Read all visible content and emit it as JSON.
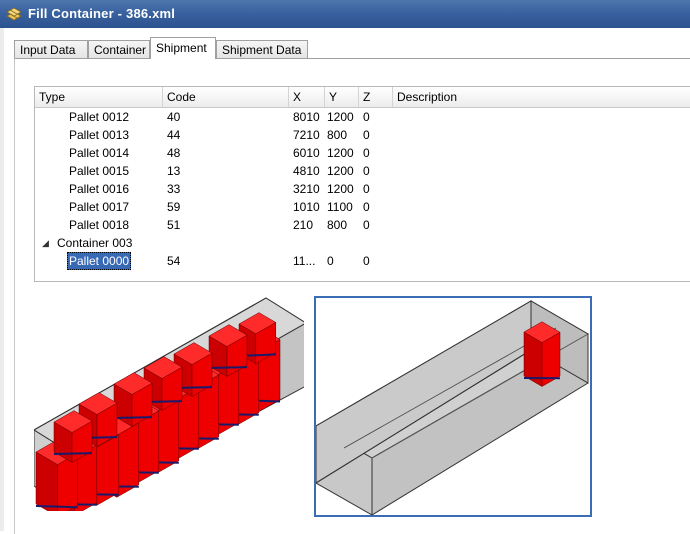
{
  "window": {
    "title": "Fill Container - 386.xml",
    "icon": "container-app-icon"
  },
  "tabs": [
    {
      "label": "Input Data",
      "active": false
    },
    {
      "label": "Container",
      "active": false
    },
    {
      "label": "Shipment",
      "active": true
    },
    {
      "label": "Shipment Data",
      "active": false
    }
  ],
  "grid": {
    "columns": [
      "Type",
      "Code",
      "X",
      "Y",
      "Z",
      "Description"
    ],
    "rows": [
      {
        "type": "Pallet 0012",
        "code": "40",
        "x": "8010",
        "y": "1200",
        "z": "0",
        "description": ""
      },
      {
        "type": "Pallet 0013",
        "code": "44",
        "x": "7210",
        "y": "800",
        "z": "0",
        "description": ""
      },
      {
        "type": "Pallet 0014",
        "code": "48",
        "x": "6010",
        "y": "1200",
        "z": "0",
        "description": ""
      },
      {
        "type": "Pallet 0015",
        "code": "13",
        "x": "4810",
        "y": "1200",
        "z": "0",
        "description": ""
      },
      {
        "type": "Pallet 0016",
        "code": "33",
        "x": "3210",
        "y": "1200",
        "z": "0",
        "description": ""
      },
      {
        "type": "Pallet 0017",
        "code": "59",
        "x": "1010",
        "y": "1100",
        "z": "0",
        "description": ""
      },
      {
        "type": "Pallet 0018",
        "code": "51",
        "x": "210",
        "y": "800",
        "z": "0",
        "description": ""
      }
    ],
    "group": {
      "label": "Container 003",
      "expanded": true
    },
    "group_rows": [
      {
        "type": "Pallet 0000",
        "code": "54",
        "x": "11...",
        "y": "0",
        "z": "0",
        "description": "",
        "selected": true
      }
    ]
  },
  "views": {
    "left": {
      "name": "full-container-3d-view",
      "pallet_color": "#ee0000"
    },
    "right": {
      "name": "selected-container-3d-view",
      "pallet_color": "#ee0000",
      "focused": true
    }
  },
  "colors": {
    "titlebar": "#3a62a0",
    "selection": "#3769b5",
    "pallet": "#ee0000",
    "container": "#c8c8c8"
  }
}
